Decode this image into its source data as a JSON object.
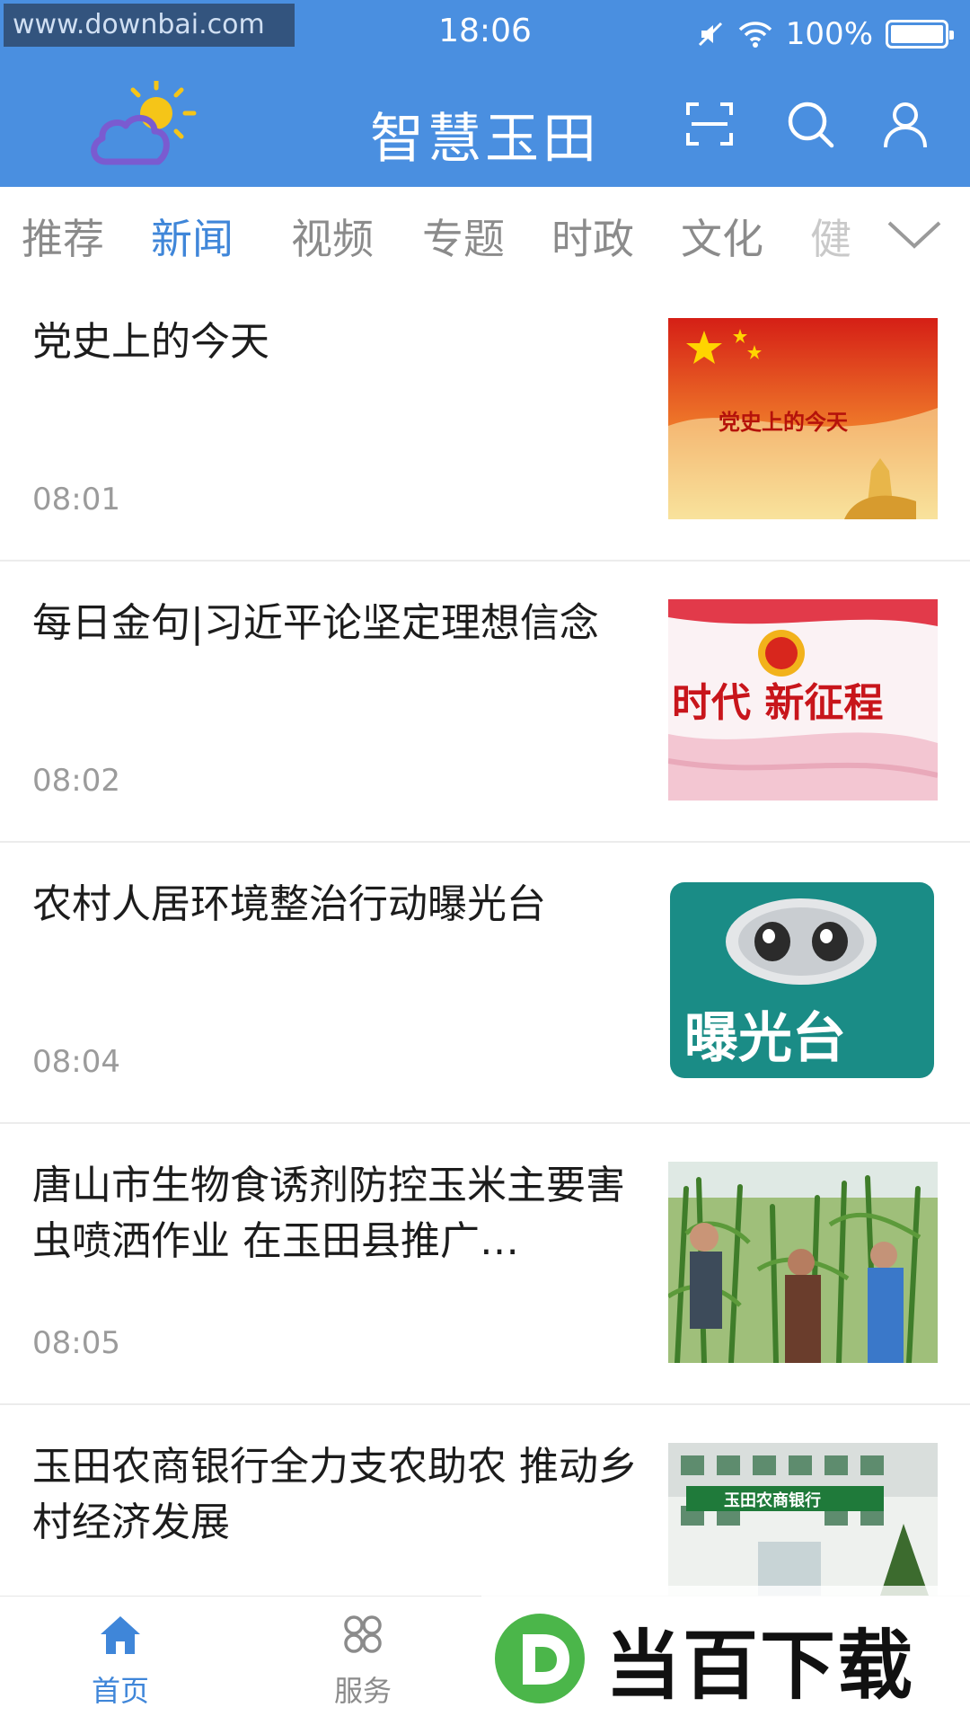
{
  "watermark": "www.downbai.com",
  "status_bar": {
    "time": "18:06",
    "battery": "100%"
  },
  "app_bar": {
    "title": "智慧玉田",
    "icons": [
      "weather-logo-icon",
      "scan-icon",
      "search-icon",
      "user-icon"
    ]
  },
  "tabs": [
    "推荐",
    "新闻",
    "视频",
    "专题",
    "时政",
    "文化",
    "健"
  ],
  "active_tab": "新闻",
  "news": [
    {
      "title": "党史上的今天",
      "time": "08:01",
      "thumb_text": "党史上的今天"
    },
    {
      "title": "每日金句|习近平论坚定理想信念",
      "time": "08:02",
      "thumb_text": "时代 新征程"
    },
    {
      "title": "农村人居环境整治行动曝光台",
      "time": "08:04",
      "thumb_text": "曝光台"
    },
    {
      "title": "唐山市生物食诱剂防控玉米主要害虫喷洒作业  在玉田县推广…",
      "time": "08:05",
      "thumb_text": ""
    },
    {
      "title": "玉田农商银行全力支农助农  推动乡村经济发展",
      "time": "",
      "thumb_text": "玉田农商银行"
    }
  ],
  "bottom_nav": {
    "home": "首页",
    "service": "服务"
  },
  "brand_watermark": "当百下载",
  "colors": {
    "primary": "#4a8fe0",
    "active_tab": "#3f86d9",
    "time_gray": "#9b9b9b"
  }
}
